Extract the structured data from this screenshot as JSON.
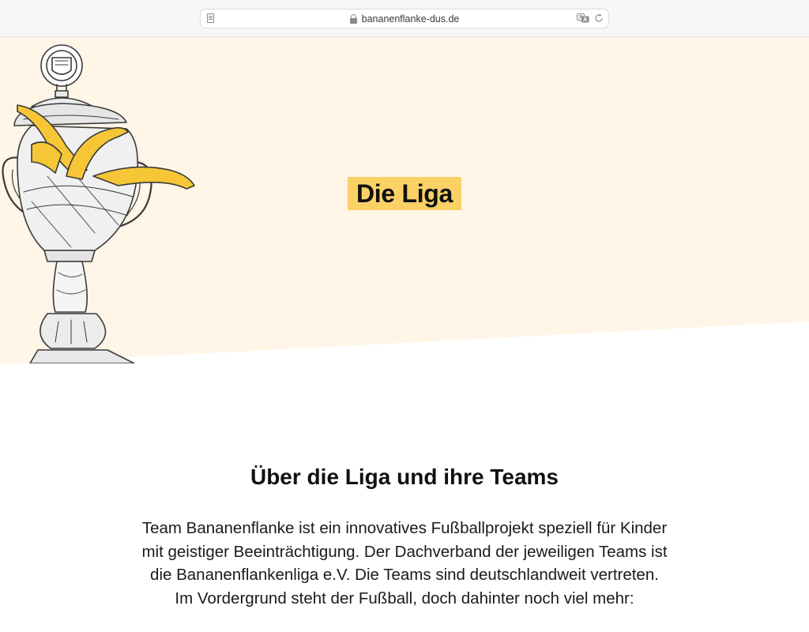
{
  "browser": {
    "url": "bananenflanke-dus.de",
    "icons": [
      "reader-mode-icon",
      "lock-icon",
      "translate-icon",
      "reload-icon"
    ]
  },
  "colors": {
    "hero_background": "#fff6e8",
    "title_highlight": "#fbd166",
    "banana_yellow": "#f6c637"
  },
  "hero": {
    "title": "Die Liga",
    "image": "trophy-with-bananas-illustration"
  },
  "about": {
    "heading": "Über die Liga und ihre Teams",
    "lines": [
      "Team Bananenflanke ist ein innovatives Fußballprojekt speziell für Kinder",
      "mit geistiger Beeinträchtigung. Der Dachverband der jeweiligen Teams ist",
      "die Bananenflankenliga e.V. Die Teams sind deutschlandweit vertreten.",
      "Im Vordergrund steht der Fußball, doch dahinter noch viel mehr:"
    ]
  }
}
